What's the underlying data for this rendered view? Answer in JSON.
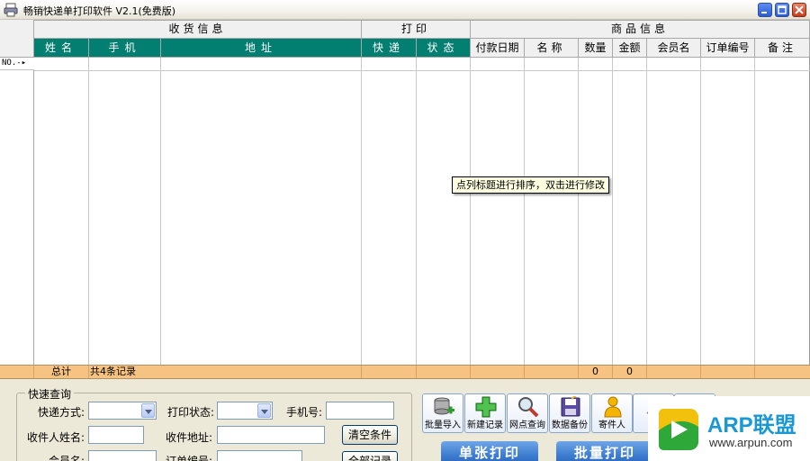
{
  "window": {
    "title": "畅销快递单打印软件 V2.1(免费版)",
    "icon": "printer-icon"
  },
  "grid": {
    "groups": [
      "收货信息",
      "打印",
      "商品信息"
    ],
    "columns": [
      "姓名",
      "手机",
      "地址",
      "快递",
      "状态",
      "付款日期",
      "名称",
      "数量",
      "金额",
      "会员名",
      "订单编号",
      "备注"
    ],
    "new_row_label": "NO.-",
    "tooltip": "点列标题进行排序，双击进行修改",
    "summary": {
      "label": "总计",
      "count_text": "共4条记录",
      "qty_total": "0",
      "amount_total": "0"
    }
  },
  "search": {
    "legend": "快速查询",
    "express_label": "快递方式:",
    "print_status_label": "打印状态:",
    "phone_label": "手机号:",
    "receiver_label": "收件人姓名:",
    "address_label": "收件地址:",
    "member_label": "会员名:",
    "order_label": "订单编号:",
    "clear_button": "清空条件",
    "all_button": "全部记录"
  },
  "toolbar": {
    "batch_import": "批量导入",
    "new_record": "新建记录",
    "outlet_query": "网点查询",
    "data_backup": "数据备份",
    "sender": "寄件人",
    "settings": "设",
    "single_print": "单张打印",
    "batch_print": "批量打印"
  },
  "watermark": {
    "main": "ARP联盟",
    "url": "www.arpun.com"
  }
}
